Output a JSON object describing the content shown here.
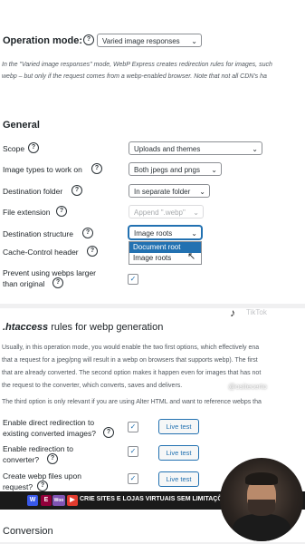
{
  "operation_mode": {
    "label": "Operation mode:",
    "help": "?",
    "value": "Varied image responses",
    "description_line1": "In the \"Varied image responses\" mode, WebP Express creates redirection rules for images, such",
    "description_line2": "webp – but only if the request comes from a webp-enabled browser. Note that not all CDN's ha"
  },
  "general": {
    "heading": "General",
    "scope": {
      "label": "Scope",
      "help": "?",
      "value": "Uploads and themes"
    },
    "image_types": {
      "label": "Image types to work on",
      "help": "?",
      "value": "Both jpegs and pngs"
    },
    "destination_folder": {
      "label": "Destination folder",
      "help": "?",
      "value": "In separate folder"
    },
    "file_extension": {
      "label": "File extension",
      "help": "?",
      "value": "Append \".webp\""
    },
    "destination_structure": {
      "label": "Destination structure",
      "help": "?",
      "value": "Image roots",
      "options": [
        "Document root",
        "Image roots"
      ],
      "highlighted_option": "Document root"
    },
    "cache_control": {
      "label": "Cache-Control header",
      "help": "?"
    },
    "prevent_larger": {
      "label_line1": "Prevent using webps larger",
      "label_line2": "than original",
      "help": "?",
      "checked_mark": "✓"
    }
  },
  "htaccess": {
    "heading_em": ".htaccess",
    "heading_rest": "rules for webp generation",
    "p1_line1": "Usually, in this operation mode, you would enable the two first options, which effectively ena",
    "p1_line2": "that a request for a jpeg/png will result in a webp on browsers that supports webp). The first",
    "p1_line3": "that are already converted. The second option makes it happen even for images that has not",
    "p1_line4": "the request to the converter, which converts, saves and delivers.",
    "p2": "The third option is only relevant if you are using Alter HTML and want to reference webps tha",
    "options": [
      {
        "line1": "Enable direct redirection to",
        "line2": "existing converted images?",
        "help": "?",
        "check": "✓",
        "button": "Live test"
      },
      {
        "line1": "Enable redirection to",
        "line2": "converter?",
        "help": "?",
        "check": "✓",
        "button": "Live test"
      },
      {
        "line1": "Create webp files upon",
        "line2": "request?",
        "help": "?",
        "check": "✓",
        "button": "Live test"
      }
    ]
  },
  "conversion": {
    "heading": "Conversion"
  },
  "overlay": {
    "tiktok_text": "TikTok",
    "watermark_handle": "@ositecerto",
    "banner_text": "CRIE SITES E LOJAS VIRTUAIS SEM LIMITAÇÕES: OSITECERTO.",
    "banner_icons": [
      "W",
      "E",
      "Woo",
      "▶"
    ]
  },
  "colors": {
    "accent": "#2271b1",
    "background": "#f0f0f1"
  }
}
